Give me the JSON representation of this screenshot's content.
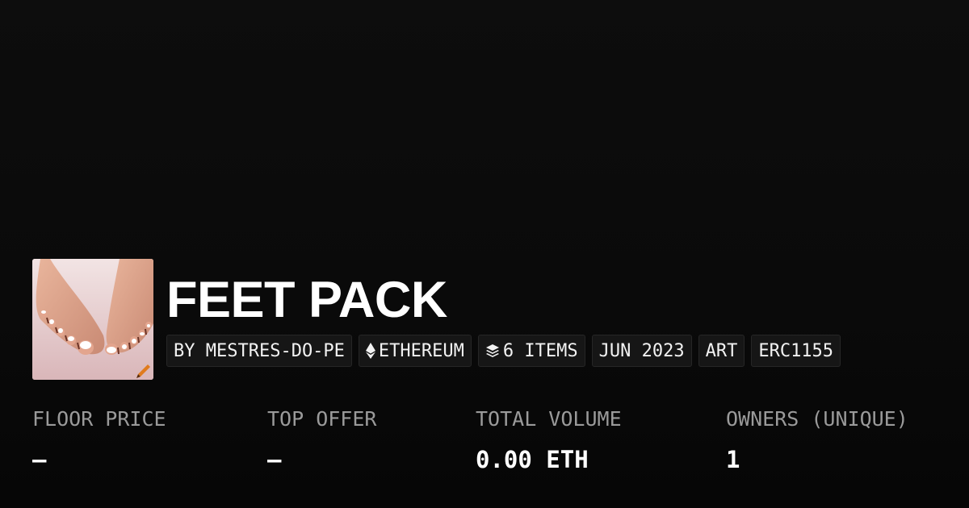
{
  "collection": {
    "title": "FEET PACK",
    "image_alt": "feet artwork",
    "tags": [
      {
        "label": "BY MESTRES-DO-PE",
        "icon": null
      },
      {
        "label": "ETHEREUM",
        "icon": "ethereum-icon"
      },
      {
        "label": "6 ITEMS",
        "icon": "layers-icon"
      },
      {
        "label": "JUN 2023",
        "icon": null
      },
      {
        "label": "ART",
        "icon": null
      },
      {
        "label": "ERC1155",
        "icon": null
      }
    ]
  },
  "stats": {
    "floor_price": {
      "label": "FLOOR PRICE",
      "value": "–"
    },
    "top_offer": {
      "label": "TOP OFFER",
      "value": "–"
    },
    "total_volume": {
      "label": "TOTAL VOLUME",
      "value": "0.00 ETH"
    },
    "owners": {
      "label": "OWNERS (UNIQUE)",
      "value": "1"
    }
  },
  "colors": {
    "background": "#0a0a0a",
    "tag_background": "#161616",
    "label_gray": "#9a9a9a",
    "text": "#ffffff"
  }
}
